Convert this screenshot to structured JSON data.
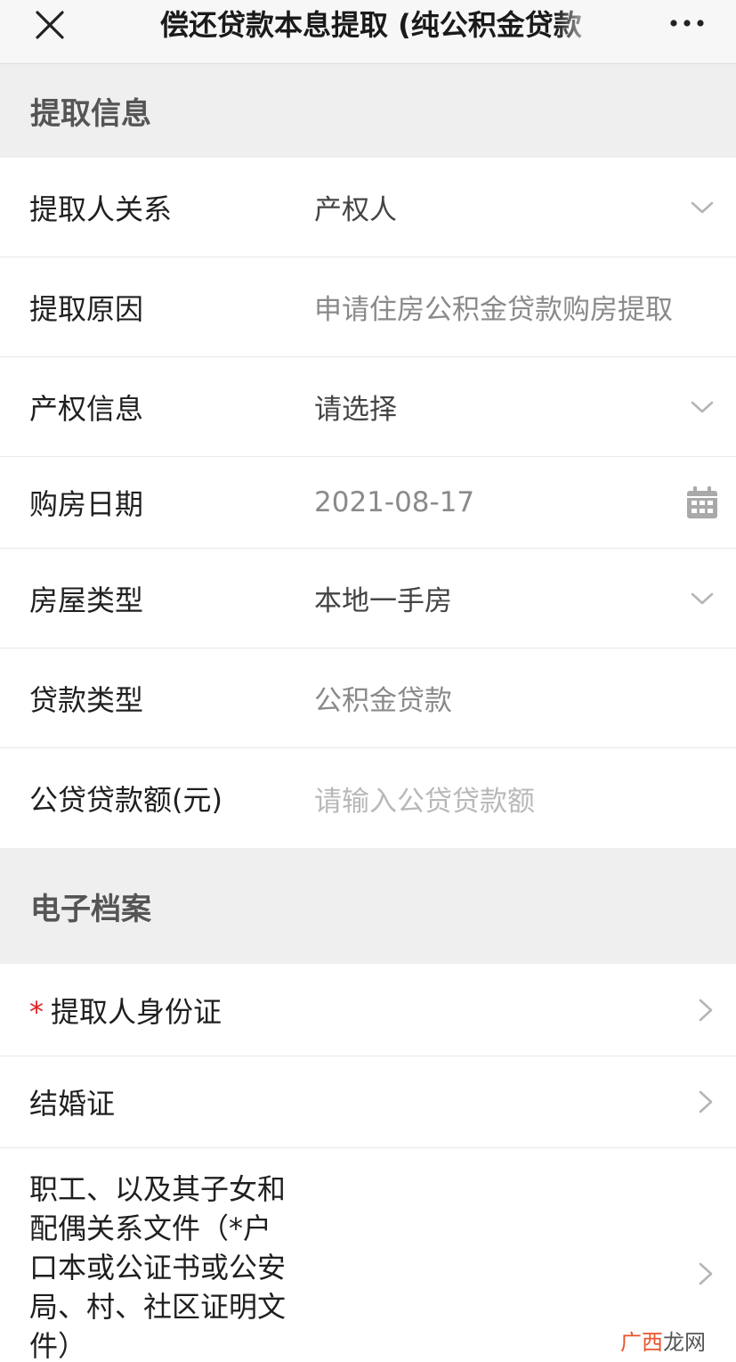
{
  "header": {
    "title": "偿还贷款本息提取 (纯公积金贷款"
  },
  "sections": {
    "withdrawal_info": "提取信息",
    "electronic_files": "电子档案"
  },
  "form": {
    "relation": {
      "label": "提取人关系",
      "value": "产权人"
    },
    "reason": {
      "label": "提取原因",
      "value": "申请住房公积金贷款购房提取"
    },
    "property_info": {
      "label": "产权信息",
      "value": "请选择"
    },
    "purchase_date": {
      "label": "购房日期",
      "value": "2021-08-17"
    },
    "house_type": {
      "label": "房屋类型",
      "value": "本地一手房"
    },
    "loan_type": {
      "label": "贷款类型",
      "value": "公积金贷款"
    },
    "loan_amount": {
      "label": "公贷贷款额(元)",
      "placeholder": "请输入公贷贷款额"
    }
  },
  "files": {
    "id_card": {
      "required_mark": "*",
      "label": "提取人身份证"
    },
    "marriage": {
      "label": "结婚证"
    },
    "relation_docs": {
      "label": "职工、以及其子女和配偶关系文件（*户口本或公证书或公安局、村、社区证明文件）"
    }
  },
  "watermark": {
    "red_part": "广西",
    "dark_part": "龙网"
  },
  "colors": {
    "accent_required": "#e02020",
    "section_bg": "#efefef",
    "watermark_red": "#e8542a"
  }
}
